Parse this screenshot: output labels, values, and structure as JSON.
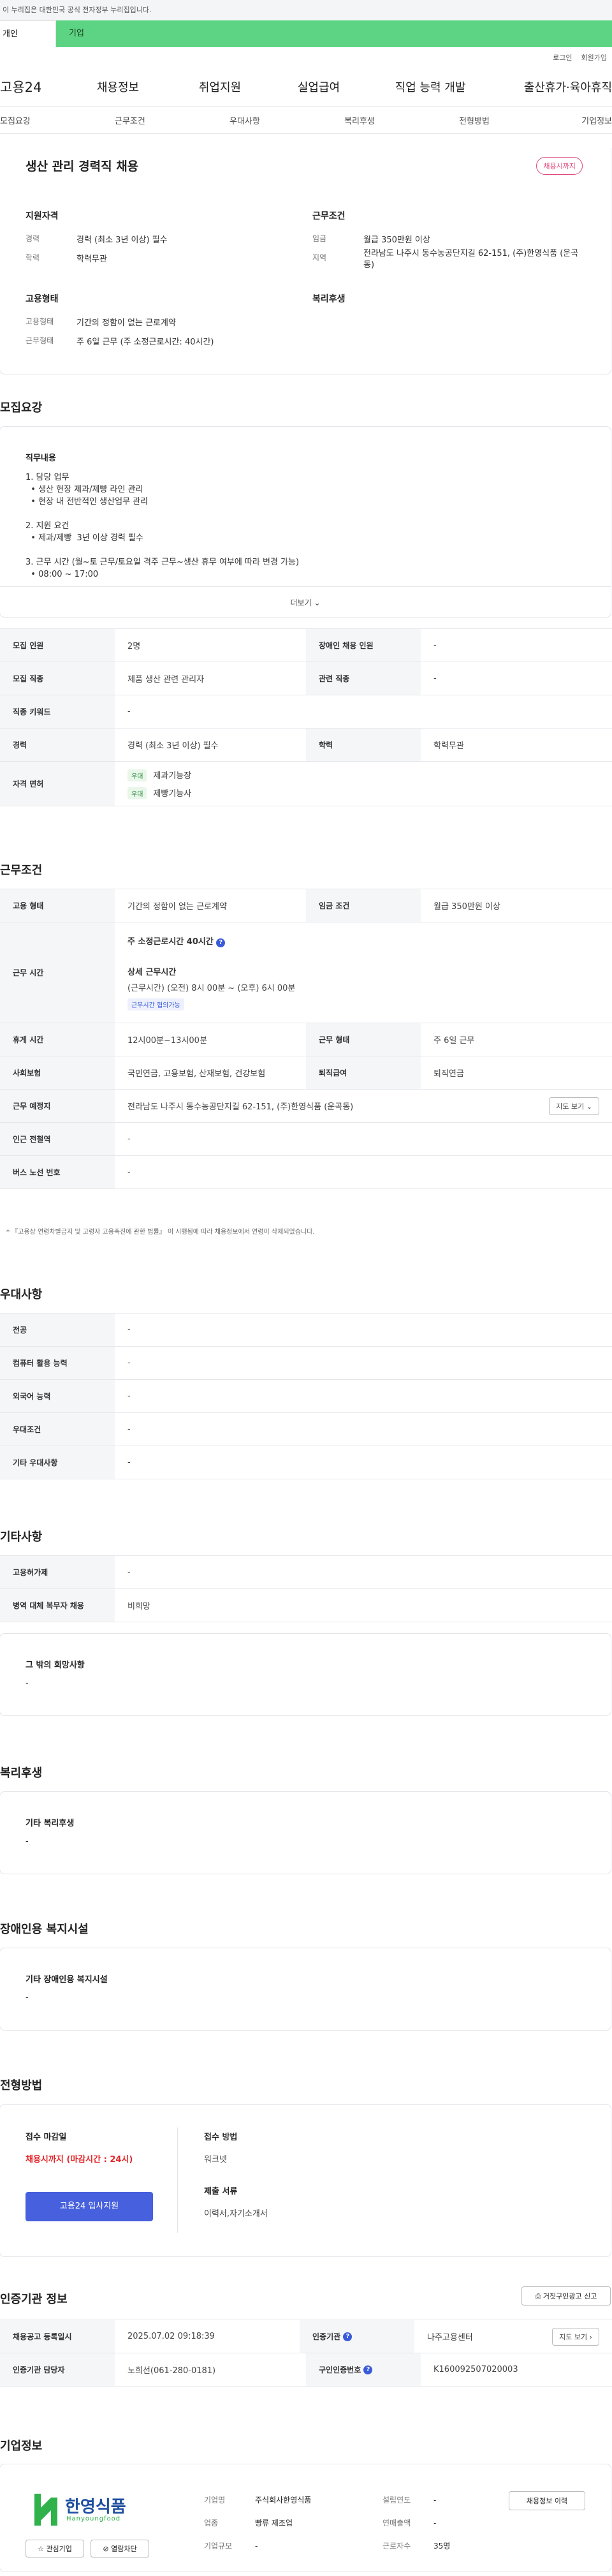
{
  "gov_banner": "이 누리집은 대한민국 공식 전자정부 누리집입니다.",
  "top_tabs": [
    "개인",
    "기업"
  ],
  "util": [
    "로그인",
    "회원가입"
  ],
  "gnb": {
    "logo": "고용24",
    "menu": [
      "채용정보",
      "취업지원",
      "실업급여",
      "직업 능력 개발",
      "출산휴가·육아휴직"
    ]
  },
  "lnb": [
    "모집요강",
    "근무조건",
    "우대사항",
    "복리후생",
    "전형방법",
    "기업정보"
  ],
  "summary": {
    "title": "생산 관리 경력직 채용",
    "deadline_badge": "채용시까지",
    "qual_title": "지원자격",
    "career_label": "경력",
    "career_value": "경력 (최소 3년 이상) 필수",
    "edu_label": "학력",
    "edu_value": "학력무관",
    "cond_title": "근무조건",
    "wage_label": "임금",
    "wage_value": "월급 350만원 이상",
    "area_label": "지역",
    "area_value": "전라남도 나주시 동수농공단지길 62-151, (주)한영식품 (운곡동)",
    "emp_title": "고용형태",
    "emptype_label": "고용형태",
    "emptype_value": "기간의 정함이 없는 근로계약",
    "worktype_label": "근무형태",
    "worktype_value": "주 6일 근무 (주 소정근로시간: 40시간)",
    "welfare_title": "복리후생"
  },
  "recruit": {
    "section_title": "모집요강",
    "duty_title": "직무내용",
    "duty_lines": [
      "1. 담당 업무",
      "  • 생산 현장 제과/제빵 라인 관리",
      "  • 현장 내 전반적인 생산업무 관리",
      "",
      "2. 지원 요건",
      "  • 제과/제빵  3년 이상 경력 필수",
      "",
      "3. 근무 시간 (월~토 근무/토요일 격주 근무~생산 휴무 여부에 따라 변경 가능)",
      "  • 08:00 ~ 17:00"
    ],
    "more_label": "더보기",
    "rows": [
      {
        "th": "모집 인원",
        "td": "2명",
        "th2": "장애인 채용 인원",
        "td2": "-"
      },
      {
        "th": "모집 직종",
        "td": "제품 생산 관련 관리자",
        "th2": "관련 직종",
        "td2": "-"
      },
      {
        "th": "직종 키워드",
        "td": "-"
      },
      {
        "th": "경력",
        "td": "경력 (최소 3년 이상) 필수",
        "th2": "학력",
        "td2": "학력무관"
      }
    ],
    "license_label": "자격 면허",
    "licenses": [
      {
        "tag": "우대",
        "name": "제과기능장"
      },
      {
        "tag": "우대",
        "name": "제빵기능사"
      }
    ]
  },
  "work": {
    "section_title": "근무조건",
    "emptype_th": "고용 형태",
    "emptype_td": "기간의 정함이 없는 근로계약",
    "wage_th": "임금 조건",
    "wage_td": "월급 350만원 이상",
    "hours_th": "근무 시간",
    "hours_weekly": "주 소정근로시간 40시간",
    "hours_detail_title": "상세 근무시간",
    "hours_detail": "(근무시간) (오전) 8시 00분 ~ (오후) 6시 00분",
    "hours_flex": "근무시간 협의가능",
    "rows": [
      {
        "th": "휴게 시간",
        "td": "12시00분~13시00분",
        "th2": "근무 형태",
        "td2": "주 6일 근무"
      },
      {
        "th": "사회보험",
        "td": "국민연금, 고용보험, 산재보험, 건강보험",
        "th2": "퇴직급여",
        "td2": "퇴직연금"
      }
    ],
    "place_th": "근무 예정지",
    "place_td": "전라남도 나주시 동수농공단지길 62-151, (주)한영식품 (운곡동)",
    "map_btn": "지도 보기",
    "station_th": "인근 전철역",
    "station_td": "-",
    "bus_th": "버스 노선 번호",
    "bus_td": "-",
    "notice": "* 『고용상 연령차별금지 및 고령자 고용촉진에 관한 법률』 이 시행됨에 따라 채용정보에서 연령이 삭제되었습니다."
  },
  "pref": {
    "section_title": "우대사항",
    "rows": [
      {
        "th": "전공",
        "td": "-"
      },
      {
        "th": "컴퓨터 활용 능력",
        "td": "-"
      },
      {
        "th": "외국어 능력",
        "td": "-"
      },
      {
        "th": "우대조건",
        "td": "-"
      },
      {
        "th": "기타 우대사항",
        "td": "-"
      }
    ]
  },
  "etc": {
    "section_title": "기타사항",
    "rows": [
      {
        "th": "고용허가제",
        "td": "-"
      },
      {
        "th": "병역 대체 복무자 채용",
        "td": "비희망"
      }
    ],
    "box_title": "그 밖의 희망사항",
    "box_value": "-"
  },
  "welfare": {
    "section_title": "복리후생",
    "box_title": "기타 복리후생",
    "box_value": "-"
  },
  "disabled": {
    "section_title": "장애인용 복지시설",
    "box_title": "기타 장애인용 복지시설",
    "box_value": "-"
  },
  "process": {
    "section_title": "전형방법",
    "deadline_title": "접수 마감일",
    "deadline_value": "채용시까지 (마감시간 : 24시)",
    "apply_btn": "고용24 입사지원",
    "method_title": "접수 방법",
    "method_value": "워크넷",
    "docs_title": "제출 서류",
    "docs_value": "이력서,자기소개서"
  },
  "cert": {
    "section_title": "인증기관 정보",
    "report_btn": "거짓구인광고 신고",
    "rows": [
      {
        "th": "채용공고 등록일시",
        "td": "2025.07.02 09:18:39",
        "th2": "인증기관",
        "td2": "나주고용센터",
        "btn": "지도 보기"
      },
      {
        "th": "인증기관 담당자",
        "td": "노희선(061-280-0181)",
        "th2": "구인인증번호",
        "td2": "K160092507020003"
      }
    ]
  },
  "company": {
    "section_title": "기업정보",
    "logo_text": "한영식품",
    "logo_sub": "Hanyoungfood",
    "fav_btn": "관심기업",
    "block_btn": "열람차단",
    "info": [
      {
        "l": "기업명",
        "v": "주식회사한영식품",
        "l2": "설립연도",
        "v2": "-"
      },
      {
        "l": "업종",
        "v": "빵류 제조업",
        "l2": "연매출액",
        "v2": "-"
      },
      {
        "l": "기업규모",
        "v": "-",
        "l2": "근로자수",
        "v2": "35명"
      }
    ],
    "history_btn": "채용정보 이력",
    "colors": {
      "logo_green": "#2fb24a",
      "logo_blue": "#1f4fa0"
    }
  },
  "colors": {
    "accent_green": "#5cd483",
    "deadline_red": "#e3262a",
    "apply_blue": "#4760dd",
    "badge_pink": "#e04a7a"
  }
}
